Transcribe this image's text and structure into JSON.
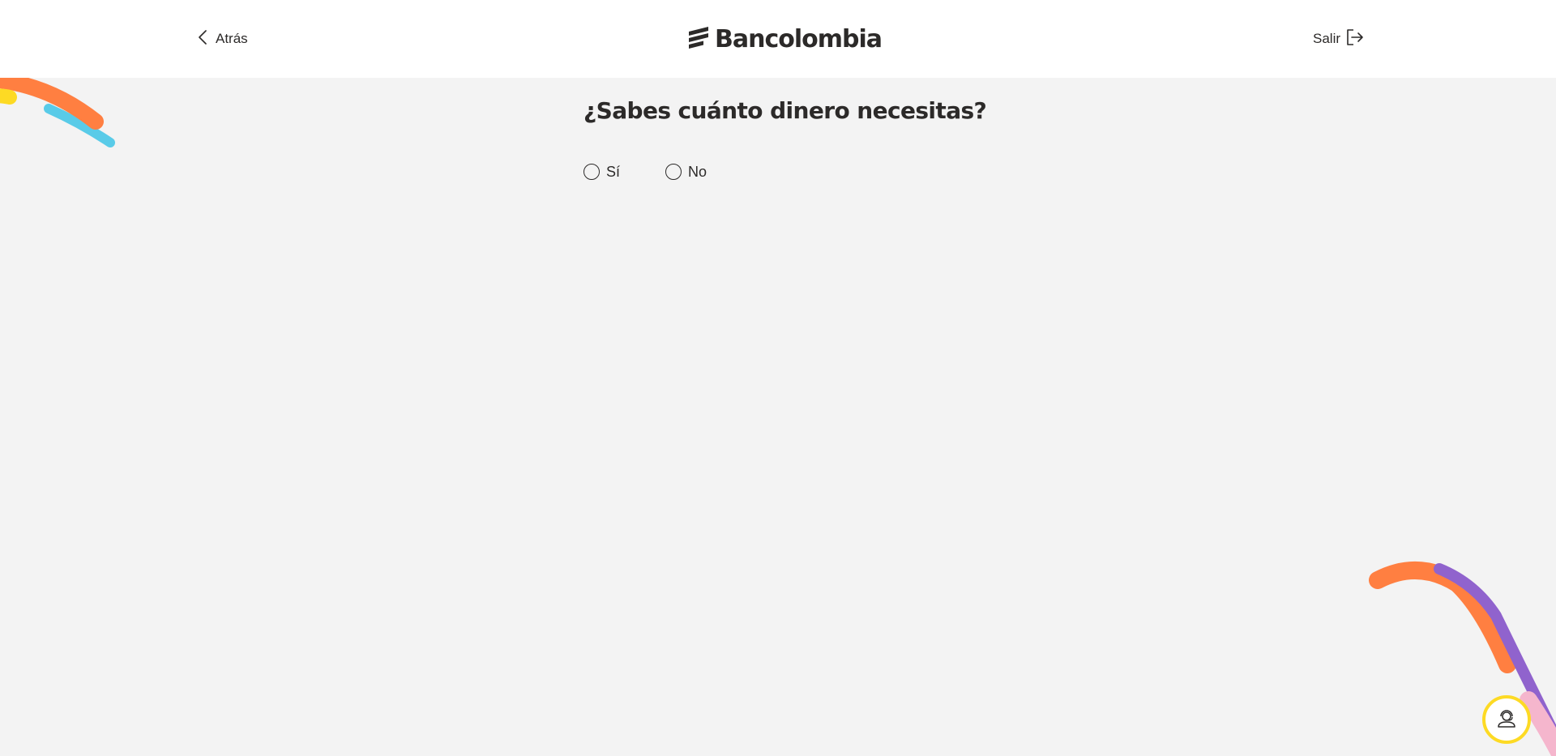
{
  "header": {
    "back_label": "Atrás",
    "logo_text": "Bancolombia",
    "exit_label": "Salir"
  },
  "question": {
    "title": "¿Sabes cuánto dinero necesitas?",
    "options": [
      {
        "label": "Sí",
        "selected": false
      },
      {
        "label": "No",
        "selected": false
      }
    ]
  },
  "icons": {
    "back": "chevron-left-icon",
    "exit": "exit-icon",
    "help": "headset-agent-icon"
  },
  "colors": {
    "background": "#f3f3f3",
    "header_bg": "#ffffff",
    "text": "#2c2a29",
    "accent_yellow": "#fdda24",
    "accent_orange": "#ff7f41",
    "accent_blue": "#59cbe8",
    "accent_purple": "#9063cd",
    "accent_pink": "#f5b6cd"
  }
}
